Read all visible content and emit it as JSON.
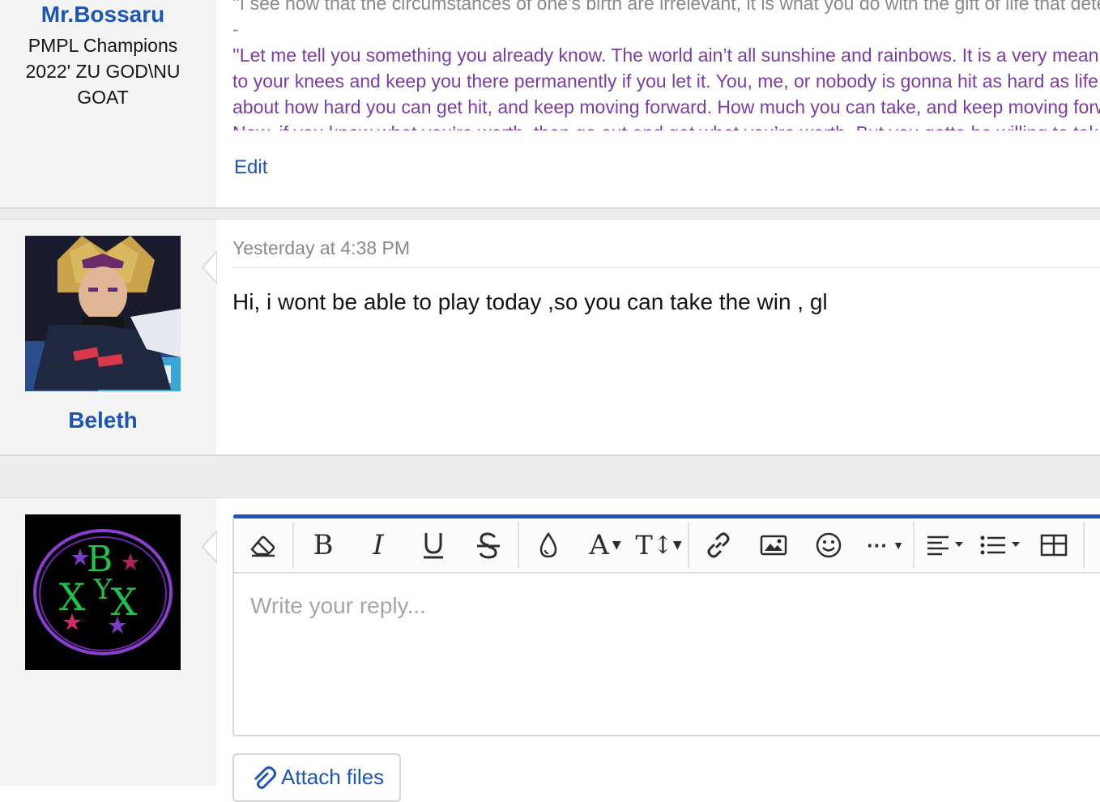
{
  "post1": {
    "username": "Mr.Bossaru",
    "user_title_lines": [
      "PMPL Champions",
      "2022' ZU GOD\\NU",
      "GOAT"
    ],
    "signature_quote_1": "''I see how that the circumstances of one's birth are irrelevant, it is what you do with the gift of life that determines who you are.''",
    "signature_dash": "-",
    "signature_lines": [
      "''Let me tell you something you already know. The world ain’t all sunshine and rainbows. It is a very mean and nasty place and it will beat you",
      "to your knees and keep you there permanently if you let it. You, me, or nobody is gonna hit as hard as life. But it ain’t",
      "about how hard you can get hit, and keep moving forward. How much you can take, and keep moving forward. That’s how winning is done.",
      "Now, if you know what you’re worth, then go out and get what you’re worth. But you gotta be willing to take the hits."
    ],
    "edit_label": "Edit"
  },
  "post2": {
    "username": "Beleth",
    "timestamp": "Yesterday at 4:38 PM",
    "message": "Hi, i wont be able to play today ,so you can take the win , gl"
  },
  "reply": {
    "placeholder": "Write your reply...",
    "attach_label": "Attach files",
    "toolbar": [
      "eraser-icon",
      "bold-icon",
      "italic-icon",
      "underline-icon",
      "strikethrough-icon",
      "text-color-icon",
      "font-family-icon",
      "font-size-icon",
      "link-icon",
      "image-icon",
      "smiley-icon",
      "more-options-icon",
      "align-icon",
      "list-icon",
      "table-icon"
    ]
  },
  "colors": {
    "link_blue": "#1d55b5",
    "signature_purple": "#7a3ea0",
    "sidebar_bg": "#f4f4f4"
  }
}
